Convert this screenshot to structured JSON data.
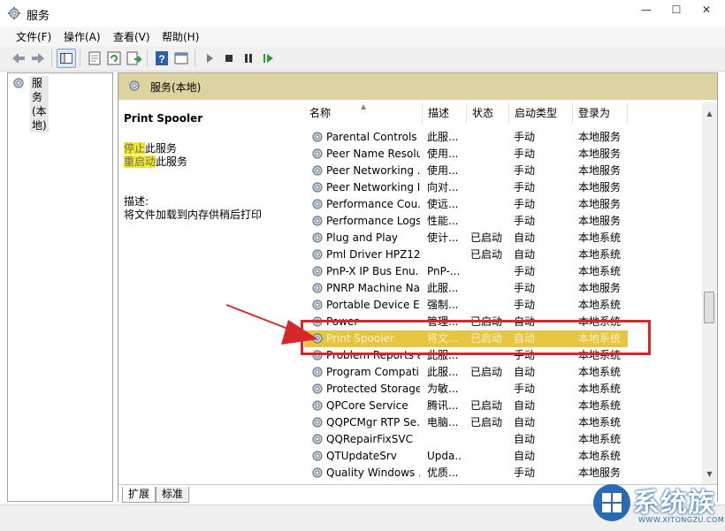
{
  "window": {
    "title": "服务",
    "minimize_glyph": "—",
    "maximize_glyph": "☐",
    "close_glyph": "✕"
  },
  "menu": [
    "文件(F)",
    "操作(A)",
    "查看(V)",
    "帮助(H)"
  ],
  "toolbar": [
    "back-icon",
    "forward-icon",
    "show-hide-tree-icon",
    "properties-icon",
    "refresh-icon",
    "export-list-icon",
    "help-icon",
    "console-icon",
    "start-service-icon",
    "stop-service-icon",
    "pause-service-icon",
    "resume-service-icon"
  ],
  "tree": {
    "item": "服务(本地)"
  },
  "header": {
    "title": "服务(本地)"
  },
  "detail": {
    "service_name": "Print Spooler",
    "stop_link": "停止",
    "stop_suffix": "此服务",
    "restart_link": "重启动",
    "restart_suffix": "此服务",
    "desc_label": "描述:",
    "desc_text": "将文件加载到内存供稍后打印"
  },
  "columns": [
    "名称",
    "描述",
    "状态",
    "启动类型",
    "登录为"
  ],
  "rows": [
    {
      "name": "Parental Controls",
      "desc": "此服...",
      "status": "",
      "startup": "手动",
      "logon": "本地服务"
    },
    {
      "name": "Peer Name Resolu...",
      "desc": "使用...",
      "status": "",
      "startup": "手动",
      "logon": "本地服务"
    },
    {
      "name": "Peer Networking ...",
      "desc": "使用...",
      "status": "",
      "startup": "手动",
      "logon": "本地服务"
    },
    {
      "name": "Peer Networking I...",
      "desc": "向对...",
      "status": "",
      "startup": "手动",
      "logon": "本地服务"
    },
    {
      "name": "Performance Cou...",
      "desc": "使远...",
      "status": "",
      "startup": "手动",
      "logon": "本地服务"
    },
    {
      "name": "Performance Logs...",
      "desc": "性能...",
      "status": "",
      "startup": "手动",
      "logon": "本地服务"
    },
    {
      "name": "Plug and Play",
      "desc": "使计...",
      "status": "已启动",
      "startup": "自动",
      "logon": "本地系统"
    },
    {
      "name": "Pml Driver HPZ12",
      "desc": "",
      "status": "已启动",
      "startup": "自动",
      "logon": "本地系统"
    },
    {
      "name": "PnP-X IP Bus Enu...",
      "desc": "PnP-...",
      "status": "",
      "startup": "手动",
      "logon": "本地系统"
    },
    {
      "name": "PNRP Machine Na...",
      "desc": "此服...",
      "status": "",
      "startup": "手动",
      "logon": "本地服务"
    },
    {
      "name": "Portable Device E...",
      "desc": "强制...",
      "status": "",
      "startup": "手动",
      "logon": "本地系统"
    },
    {
      "name": "Power",
      "desc": "管理...",
      "status": "已启动",
      "startup": "自动",
      "logon": "本地系统"
    },
    {
      "name": "Print Spooler",
      "desc": "将文...",
      "status": "已启动",
      "startup": "自动",
      "logon": "本地系统",
      "selected": true
    },
    {
      "name": "Problem Reports a...",
      "desc": "此服...",
      "status": "",
      "startup": "手动",
      "logon": "本地系统"
    },
    {
      "name": "Program Compati...",
      "desc": "此服...",
      "status": "已启动",
      "startup": "自动",
      "logon": "本地系统"
    },
    {
      "name": "Protected Storage",
      "desc": "为敏...",
      "status": "",
      "startup": "手动",
      "logon": "本地系统"
    },
    {
      "name": "QPCore Service",
      "desc": "腾讯...",
      "status": "已启动",
      "startup": "自动",
      "logon": "本地系统"
    },
    {
      "name": "QQPCMgr RTP Se...",
      "desc": "电脑...",
      "status": "已启动",
      "startup": "自动",
      "logon": "本地系统"
    },
    {
      "name": "QQRepairFixSVC",
      "desc": "",
      "status": "",
      "startup": "自动",
      "logon": "本地系统"
    },
    {
      "name": "QTUpdateSrv",
      "desc": "Upda...",
      "status": "",
      "startup": "自动",
      "logon": "本地系统"
    },
    {
      "name": "Quality Windows ...",
      "desc": "优质...",
      "status": "",
      "startup": "手动",
      "logon": "本地服务"
    }
  ],
  "tabs": [
    "扩展",
    "标准"
  ],
  "watermark": {
    "main": "系统族",
    "sub": "WWW.XITONGZU.COM"
  },
  "colors": {
    "header_bg": "#ddd3a0",
    "selected_row": "#e8c540",
    "annotation_red": "#d8272a",
    "link_highlight": "#f0e82a"
  }
}
